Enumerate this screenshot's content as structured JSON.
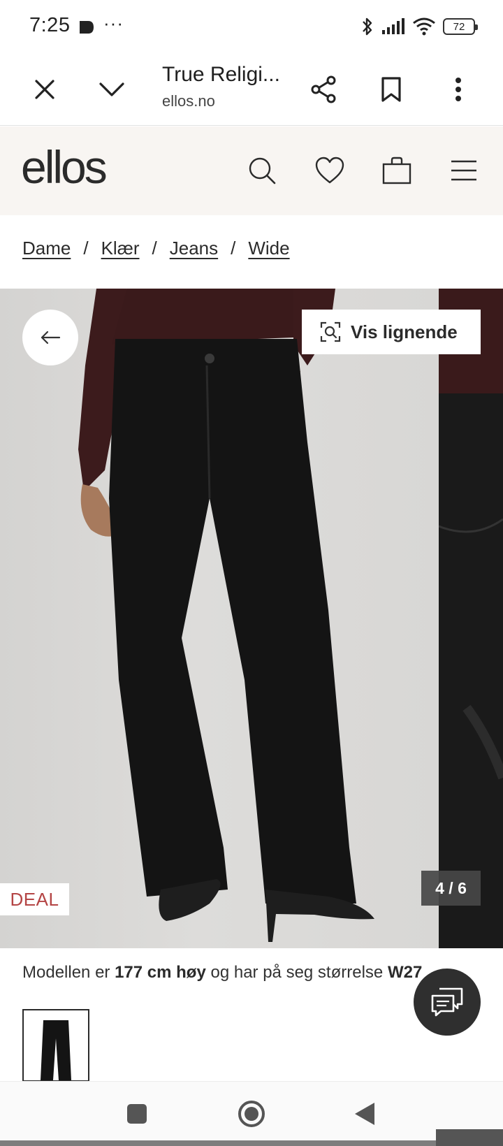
{
  "status_bar": {
    "time": "7:25",
    "more": "···",
    "battery": "72"
  },
  "toolbar": {
    "title": "True Religi...",
    "url": "ellos.no"
  },
  "site": {
    "logo": "ellos",
    "icons": [
      "search-icon",
      "heart-icon",
      "bag-icon",
      "menu-icon"
    ]
  },
  "breadcrumb": {
    "items": [
      "Dame",
      "Klær",
      "Jeans",
      "Wide"
    ],
    "separator": "/"
  },
  "gallery": {
    "similar_label": "Vis lignende",
    "badge": "DEAL",
    "counter": "4 / 6"
  },
  "model_info": {
    "part1": "Modellen er ",
    "height": "177 cm høy",
    "part2": " og har på seg størrelse ",
    "size": "W27"
  },
  "colors": {
    "header_bg": "#f8f5f2",
    "deal_red": "#b44545",
    "text": "#2b2b2b"
  }
}
